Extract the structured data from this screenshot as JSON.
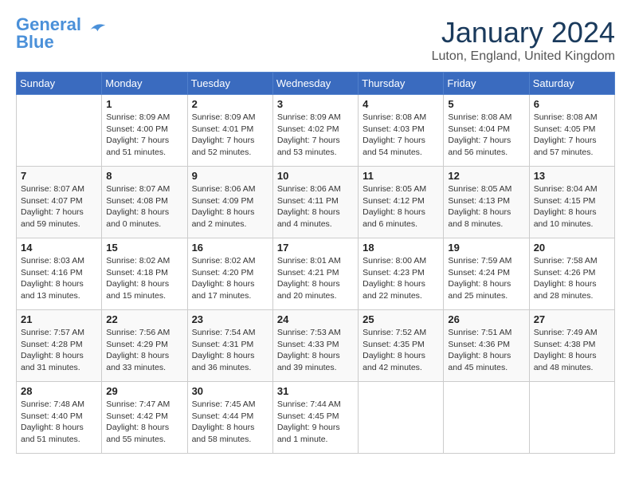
{
  "logo": {
    "line1": "General",
    "line2": "Blue"
  },
  "title": "January 2024",
  "location": "Luton, England, United Kingdom",
  "days_of_week": [
    "Sunday",
    "Monday",
    "Tuesday",
    "Wednesday",
    "Thursday",
    "Friday",
    "Saturday"
  ],
  "weeks": [
    [
      {
        "num": "",
        "sunrise": "",
        "sunset": "",
        "daylight": ""
      },
      {
        "num": "1",
        "sunrise": "Sunrise: 8:09 AM",
        "sunset": "Sunset: 4:00 PM",
        "daylight": "Daylight: 7 hours and 51 minutes."
      },
      {
        "num": "2",
        "sunrise": "Sunrise: 8:09 AM",
        "sunset": "Sunset: 4:01 PM",
        "daylight": "Daylight: 7 hours and 52 minutes."
      },
      {
        "num": "3",
        "sunrise": "Sunrise: 8:09 AM",
        "sunset": "Sunset: 4:02 PM",
        "daylight": "Daylight: 7 hours and 53 minutes."
      },
      {
        "num": "4",
        "sunrise": "Sunrise: 8:08 AM",
        "sunset": "Sunset: 4:03 PM",
        "daylight": "Daylight: 7 hours and 54 minutes."
      },
      {
        "num": "5",
        "sunrise": "Sunrise: 8:08 AM",
        "sunset": "Sunset: 4:04 PM",
        "daylight": "Daylight: 7 hours and 56 minutes."
      },
      {
        "num": "6",
        "sunrise": "Sunrise: 8:08 AM",
        "sunset": "Sunset: 4:05 PM",
        "daylight": "Daylight: 7 hours and 57 minutes."
      }
    ],
    [
      {
        "num": "7",
        "sunrise": "Sunrise: 8:07 AM",
        "sunset": "Sunset: 4:07 PM",
        "daylight": "Daylight: 7 hours and 59 minutes."
      },
      {
        "num": "8",
        "sunrise": "Sunrise: 8:07 AM",
        "sunset": "Sunset: 4:08 PM",
        "daylight": "Daylight: 8 hours and 0 minutes."
      },
      {
        "num": "9",
        "sunrise": "Sunrise: 8:06 AM",
        "sunset": "Sunset: 4:09 PM",
        "daylight": "Daylight: 8 hours and 2 minutes."
      },
      {
        "num": "10",
        "sunrise": "Sunrise: 8:06 AM",
        "sunset": "Sunset: 4:11 PM",
        "daylight": "Daylight: 8 hours and 4 minutes."
      },
      {
        "num": "11",
        "sunrise": "Sunrise: 8:05 AM",
        "sunset": "Sunset: 4:12 PM",
        "daylight": "Daylight: 8 hours and 6 minutes."
      },
      {
        "num": "12",
        "sunrise": "Sunrise: 8:05 AM",
        "sunset": "Sunset: 4:13 PM",
        "daylight": "Daylight: 8 hours and 8 minutes."
      },
      {
        "num": "13",
        "sunrise": "Sunrise: 8:04 AM",
        "sunset": "Sunset: 4:15 PM",
        "daylight": "Daylight: 8 hours and 10 minutes."
      }
    ],
    [
      {
        "num": "14",
        "sunrise": "Sunrise: 8:03 AM",
        "sunset": "Sunset: 4:16 PM",
        "daylight": "Daylight: 8 hours and 13 minutes."
      },
      {
        "num": "15",
        "sunrise": "Sunrise: 8:02 AM",
        "sunset": "Sunset: 4:18 PM",
        "daylight": "Daylight: 8 hours and 15 minutes."
      },
      {
        "num": "16",
        "sunrise": "Sunrise: 8:02 AM",
        "sunset": "Sunset: 4:20 PM",
        "daylight": "Daylight: 8 hours and 17 minutes."
      },
      {
        "num": "17",
        "sunrise": "Sunrise: 8:01 AM",
        "sunset": "Sunset: 4:21 PM",
        "daylight": "Daylight: 8 hours and 20 minutes."
      },
      {
        "num": "18",
        "sunrise": "Sunrise: 8:00 AM",
        "sunset": "Sunset: 4:23 PM",
        "daylight": "Daylight: 8 hours and 22 minutes."
      },
      {
        "num": "19",
        "sunrise": "Sunrise: 7:59 AM",
        "sunset": "Sunset: 4:24 PM",
        "daylight": "Daylight: 8 hours and 25 minutes."
      },
      {
        "num": "20",
        "sunrise": "Sunrise: 7:58 AM",
        "sunset": "Sunset: 4:26 PM",
        "daylight": "Daylight: 8 hours and 28 minutes."
      }
    ],
    [
      {
        "num": "21",
        "sunrise": "Sunrise: 7:57 AM",
        "sunset": "Sunset: 4:28 PM",
        "daylight": "Daylight: 8 hours and 31 minutes."
      },
      {
        "num": "22",
        "sunrise": "Sunrise: 7:56 AM",
        "sunset": "Sunset: 4:29 PM",
        "daylight": "Daylight: 8 hours and 33 minutes."
      },
      {
        "num": "23",
        "sunrise": "Sunrise: 7:54 AM",
        "sunset": "Sunset: 4:31 PM",
        "daylight": "Daylight: 8 hours and 36 minutes."
      },
      {
        "num": "24",
        "sunrise": "Sunrise: 7:53 AM",
        "sunset": "Sunset: 4:33 PM",
        "daylight": "Daylight: 8 hours and 39 minutes."
      },
      {
        "num": "25",
        "sunrise": "Sunrise: 7:52 AM",
        "sunset": "Sunset: 4:35 PM",
        "daylight": "Daylight: 8 hours and 42 minutes."
      },
      {
        "num": "26",
        "sunrise": "Sunrise: 7:51 AM",
        "sunset": "Sunset: 4:36 PM",
        "daylight": "Daylight: 8 hours and 45 minutes."
      },
      {
        "num": "27",
        "sunrise": "Sunrise: 7:49 AM",
        "sunset": "Sunset: 4:38 PM",
        "daylight": "Daylight: 8 hours and 48 minutes."
      }
    ],
    [
      {
        "num": "28",
        "sunrise": "Sunrise: 7:48 AM",
        "sunset": "Sunset: 4:40 PM",
        "daylight": "Daylight: 8 hours and 51 minutes."
      },
      {
        "num": "29",
        "sunrise": "Sunrise: 7:47 AM",
        "sunset": "Sunset: 4:42 PM",
        "daylight": "Daylight: 8 hours and 55 minutes."
      },
      {
        "num": "30",
        "sunrise": "Sunrise: 7:45 AM",
        "sunset": "Sunset: 4:44 PM",
        "daylight": "Daylight: 8 hours and 58 minutes."
      },
      {
        "num": "31",
        "sunrise": "Sunrise: 7:44 AM",
        "sunset": "Sunset: 4:45 PM",
        "daylight": "Daylight: 9 hours and 1 minute."
      },
      {
        "num": "",
        "sunrise": "",
        "sunset": "",
        "daylight": ""
      },
      {
        "num": "",
        "sunrise": "",
        "sunset": "",
        "daylight": ""
      },
      {
        "num": "",
        "sunrise": "",
        "sunset": "",
        "daylight": ""
      }
    ]
  ]
}
